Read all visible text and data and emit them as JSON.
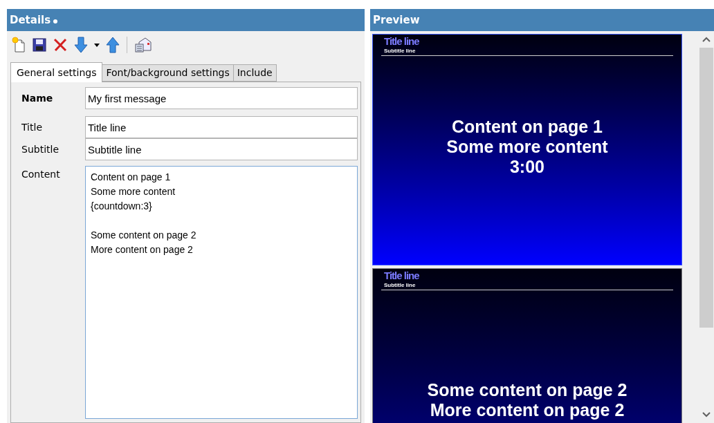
{
  "details": {
    "title": "Details",
    "modified": true,
    "toolbar": [
      {
        "kind": "new"
      },
      {
        "kind": "save"
      },
      {
        "kind": "delete"
      },
      {
        "kind": "down"
      },
      {
        "kind": "dropdown"
      },
      {
        "kind": "up"
      },
      {
        "kind": "separator"
      },
      {
        "kind": "send"
      }
    ],
    "tabs": [
      {
        "label": "General settings",
        "selected": true
      },
      {
        "label": "Font/background settings",
        "selected": false
      },
      {
        "label": "Include",
        "selected": false
      }
    ],
    "fields": [
      {
        "label": "Name",
        "value": "My first message",
        "kind": "bold"
      },
      {
        "label": "Title",
        "value": "Title line",
        "kind": "plain"
      },
      {
        "label": "Subtitle",
        "value": "Subtitle line",
        "kind": "plain"
      }
    ],
    "content": {
      "label": "Content",
      "value": "Content on page 1\nSome more content\n{countdown:3}\n\nSome content on page 2\nMore content on page 2"
    }
  },
  "preview": {
    "title": "Preview",
    "slides": [
      {
        "title": "Title line",
        "subtitle": "Subtitle line",
        "lines": [
          "Content on page 1",
          "Some more content",
          "3:00"
        ],
        "selected": true
      },
      {
        "title": "Title line",
        "subtitle": "Subtitle line",
        "lines": [
          "Some content on page 2",
          "More content on page 2"
        ],
        "selected": false
      }
    ]
  }
}
